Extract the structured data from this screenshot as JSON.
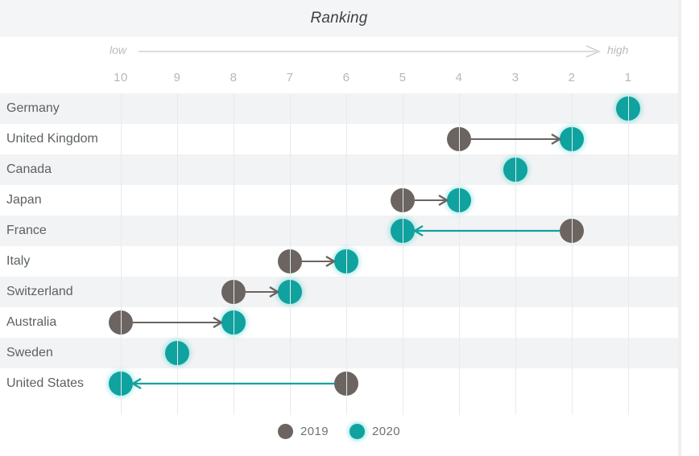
{
  "header": {
    "title": "Ranking"
  },
  "axis": {
    "low_label": "low",
    "high_label": "high",
    "arrow_icon": "right-arrow-icon",
    "tick_labels": [
      "10",
      "9",
      "8",
      "7",
      "6",
      "5",
      "4",
      "3",
      "2",
      "1"
    ]
  },
  "legend": {
    "position": "bottom-center",
    "items": [
      {
        "label": "2019",
        "color": "#6b6461",
        "swatch_icon": "circle-marker-icon"
      },
      {
        "label": "2020",
        "color": "#0fa29f",
        "swatch_icon": "circle-marker-icon"
      }
    ]
  },
  "colors": {
    "series_2019": "#6b6461",
    "series_2020": "#0fa29f",
    "title_band": "#f4f5f6",
    "row_stripe": "#f2f3f4",
    "gridline": "#e9eaec",
    "label_text": "#5d6164",
    "tick_text": "#b4b7b9"
  },
  "chart_data": {
    "type": "scatter",
    "subtype": "dumbbell-slope-ranking",
    "title": "Ranking",
    "xlabel": "",
    "ylabel": "",
    "xlim": [
      10.5,
      0.5
    ],
    "x_inverted": true,
    "grid": true,
    "x_ticks": [
      10,
      9,
      8,
      7,
      6,
      5,
      4,
      3,
      2,
      1
    ],
    "axis_direction_annotations": {
      "left": "low",
      "right": "high"
    },
    "categories": [
      "Germany",
      "United Kingdom",
      "Canada",
      "Japan",
      "France",
      "Italy",
      "Switzerland",
      "Australia",
      "Sweden",
      "United States"
    ],
    "series": [
      {
        "name": "2019",
        "color": "#6b6461",
        "values": [
          null,
          4,
          null,
          5,
          2,
          7,
          8,
          10,
          null,
          6
        ]
      },
      {
        "name": "2020",
        "color": "#0fa29f",
        "values": [
          1,
          2,
          3,
          4,
          5,
          6,
          7,
          8,
          9,
          10
        ]
      }
    ],
    "rows": [
      {
        "country": "Germany",
        "rank_2019": null,
        "rank_2020": 1,
        "change": null,
        "arrow": "none"
      },
      {
        "country": "United Kingdom",
        "rank_2019": 4,
        "rank_2020": 2,
        "change": 2,
        "arrow": "improved-right"
      },
      {
        "country": "Canada",
        "rank_2019": null,
        "rank_2020": 3,
        "change": null,
        "arrow": "none"
      },
      {
        "country": "Japan",
        "rank_2019": 5,
        "rank_2020": 4,
        "change": 1,
        "arrow": "improved-right"
      },
      {
        "country": "France",
        "rank_2019": 2,
        "rank_2020": 5,
        "change": -3,
        "arrow": "declined-left"
      },
      {
        "country": "Italy",
        "rank_2019": 7,
        "rank_2020": 6,
        "change": 1,
        "arrow": "improved-right"
      },
      {
        "country": "Switzerland",
        "rank_2019": 8,
        "rank_2020": 7,
        "change": 1,
        "arrow": "improved-right"
      },
      {
        "country": "Australia",
        "rank_2019": 10,
        "rank_2020": 8,
        "change": 2,
        "arrow": "improved-right"
      },
      {
        "country": "Sweden",
        "rank_2019": null,
        "rank_2020": 9,
        "change": null,
        "arrow": "none"
      },
      {
        "country": "United States",
        "rank_2019": 6,
        "rank_2020": 10,
        "change": -4,
        "arrow": "declined-left"
      }
    ]
  }
}
